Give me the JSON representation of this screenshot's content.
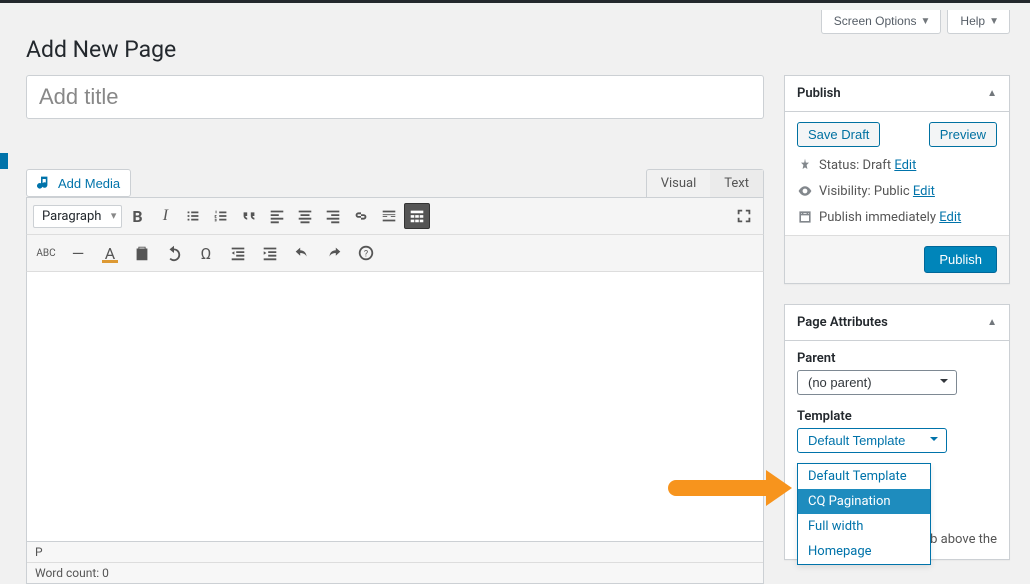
{
  "header": {
    "screen_options": "Screen Options",
    "help": "Help"
  },
  "page_title": "Add New Page",
  "title_input": {
    "placeholder": "Add title",
    "value": ""
  },
  "media_btn": "Add Media",
  "editor_tabs": {
    "visual": "Visual",
    "text": "Text"
  },
  "format_select": "Paragraph",
  "path_label": "P",
  "word_count_label": "Word count: 0",
  "publish": {
    "panel_title": "Publish",
    "save_draft": "Save Draft",
    "preview": "Preview",
    "status_prefix": "Status: ",
    "status_value": "Draft",
    "visibility_prefix": "Visibility: ",
    "visibility_value": "Public",
    "schedule_prefix": "Publish ",
    "schedule_value": "immediately",
    "edit_link": "Edit",
    "publish_btn": "Publish"
  },
  "attributes": {
    "panel_title": "Page Attributes",
    "parent_label": "Parent",
    "parent_value": "(no parent)",
    "template_label": "Template",
    "template_value": "Default Template",
    "template_options": [
      "Default Template",
      "CQ Pagination",
      "Full width",
      "Homepage"
    ],
    "help_fragment_1": "ab above the"
  }
}
